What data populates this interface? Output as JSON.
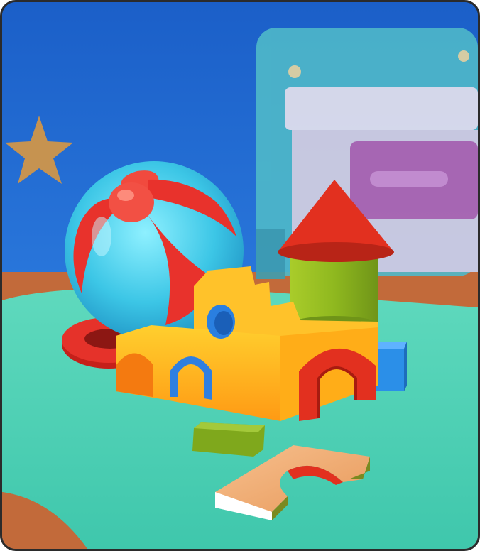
{
  "scene": {
    "description_label": "",
    "objects": [
      {
        "name": "beach-ball",
        "colors": [
          "#e8322c",
          "#3cc6e6"
        ]
      },
      {
        "name": "red-ring",
        "colors": [
          "#e02a22"
        ]
      },
      {
        "name": "yellow-arch-block",
        "colors": [
          "#ffb21c"
        ]
      },
      {
        "name": "blue-arch",
        "colors": [
          "#2f7fe0"
        ]
      },
      {
        "name": "red-arch",
        "colors": [
          "#e2301f"
        ]
      },
      {
        "name": "green-cylinder",
        "colors": [
          "#8fb81f"
        ]
      },
      {
        "name": "red-cone-roof",
        "colors": [
          "#e2301f"
        ]
      },
      {
        "name": "blue-cube",
        "colors": [
          "#2b8fe8"
        ]
      },
      {
        "name": "green-square-block",
        "colors": [
          "#7fa81c"
        ]
      },
      {
        "name": "wood-arch-block",
        "colors": [
          "#f3b27a"
        ]
      },
      {
        "name": "star-decoration",
        "colors": [
          "#e39a3a"
        ]
      },
      {
        "name": "nightstand",
        "colors": [
          "#4fb9c9"
        ]
      }
    ],
    "palette": {
      "wall": "#1f66cc",
      "rug": "#4fd6b6",
      "floor": "#c26a3a",
      "frame": "#2b2b2b"
    }
  }
}
